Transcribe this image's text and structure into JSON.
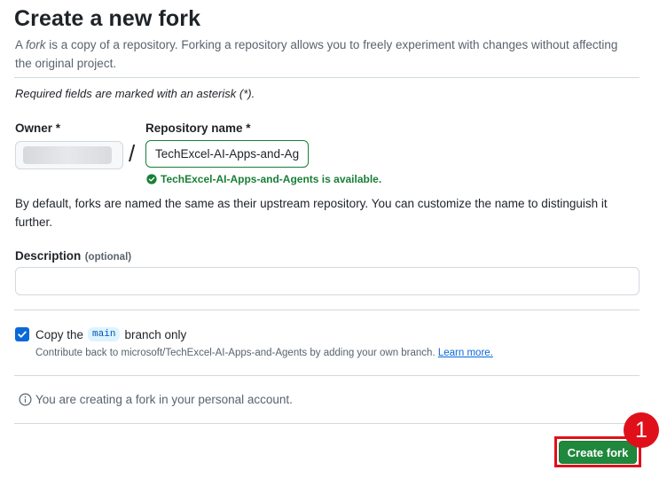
{
  "page": {
    "title": "Create a new fork",
    "description_prefix": "A ",
    "description_em": "fork",
    "description_suffix": " is a copy of a repository. Forking a repository allows you to freely experiment with changes without affecting the original project.",
    "required_note": "Required fields are marked with an asterisk (*)."
  },
  "owner": {
    "label": "Owner *",
    "value": ""
  },
  "repository": {
    "label": "Repository name *",
    "value": "TechExcel-AI-Apps-and-Agents",
    "availability": "TechExcel-AI-Apps-and-Agents is available.",
    "separator": "/"
  },
  "naming_note": "By default, forks are named the same as their upstream repository. You can customize the name to distinguish it further.",
  "description_field": {
    "label": "Description",
    "optional": "(optional)",
    "value": "",
    "placeholder": ""
  },
  "copy_branch": {
    "checked": true,
    "label_before": "Copy the",
    "branch": "main",
    "label_after": "branch only",
    "help": "Contribute back to microsoft/TechExcel-AI-Apps-and-Agents by adding your own branch.",
    "learn_more": "Learn more."
  },
  "info_message": "You are creating a fork in your personal account.",
  "submit": {
    "label": "Create fork"
  },
  "annotation": {
    "step": "1",
    "color": "#e0101a"
  },
  "colors": {
    "primary_button": "#1f883d",
    "success": "#1a7f37",
    "accent": "#0969da"
  },
  "icons": {
    "available": "check-circle-icon",
    "checkbox": "check-icon",
    "info": "info-icon"
  }
}
